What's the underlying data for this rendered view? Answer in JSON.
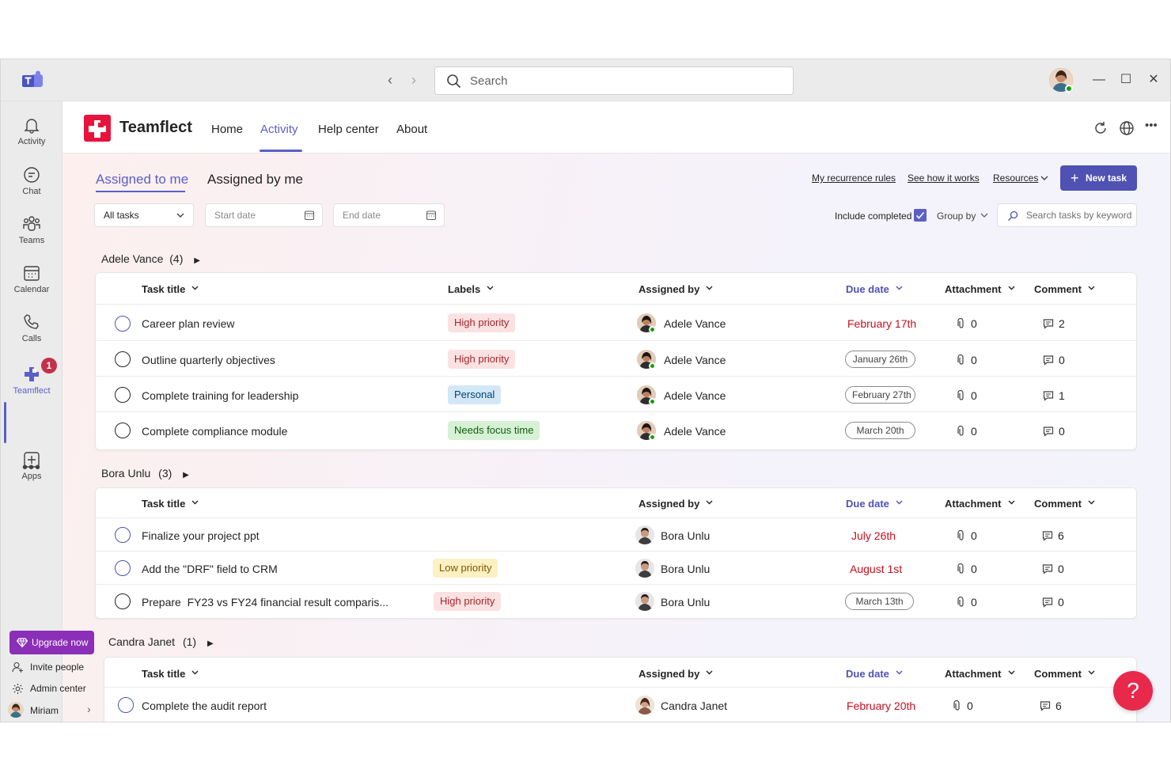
{
  "search": {
    "placeholder": "Search"
  },
  "rail": {
    "items": [
      {
        "label": "Activity",
        "icon": "bell-icon"
      },
      {
        "label": "Chat",
        "icon": "chat-icon"
      },
      {
        "label": "Teams",
        "icon": "teams-icon"
      },
      {
        "label": "Calendar",
        "icon": "calendar-icon"
      },
      {
        "label": "Calls",
        "icon": "phone-icon"
      },
      {
        "label": "Teamflect",
        "icon": "teamflect-icon",
        "badge": "1"
      },
      {
        "label": "Apps",
        "icon": "add-apps-icon"
      }
    ]
  },
  "app": {
    "name": "Teamflect",
    "tabs": [
      "Home",
      "Activity",
      "Help center",
      "About"
    ],
    "active_tab": "Activity"
  },
  "subtabs": [
    "Assigned to me",
    "Assigned by me"
  ],
  "links": {
    "recurrence": "My recurrence rules",
    "how": "See how it works",
    "resources": "Resources"
  },
  "new_task": "New task",
  "filters": {
    "task_filter": "All tasks",
    "start_date": "Start date",
    "end_date": "End date",
    "include_completed": "Include completed",
    "group_by": "Group by",
    "search_placeholder": "Search tasks by keyword"
  },
  "columns": {
    "title": "Task title",
    "labels": "Labels",
    "assigned_by": "Assigned by",
    "due": "Due date",
    "attachment": "Attachment",
    "comment": "Comment"
  },
  "groups": [
    {
      "name": "Adele Vance",
      "count": "(4)",
      "tasks": [
        {
          "title": "Career plan review",
          "label": "High priority",
          "by": "Adele Vance",
          "due": "February 17th",
          "attach": "0",
          "comments": "2"
        },
        {
          "title": "Outline quarterly objectives",
          "label": "High priority",
          "by": "Adele Vance",
          "due": "January 26th",
          "attach": "0",
          "comments": "0"
        },
        {
          "title": "Complete training for leadership",
          "label": "Personal",
          "by": "Adele Vance",
          "due": "February 27th",
          "attach": "0",
          "comments": "1"
        },
        {
          "title": "Complete compliance module",
          "label": "Needs focus time",
          "by": "Adele Vance",
          "due": "March 20th",
          "attach": "0",
          "comments": "0"
        }
      ]
    },
    {
      "name": "Bora Unlu",
      "count": "(3)",
      "tasks": [
        {
          "title": "Finalize your project ppt",
          "label": "",
          "by": "Bora Unlu",
          "due": "July 26th",
          "attach": "0",
          "comments": "6"
        },
        {
          "title": "Add the \"DRF\" field to CRM",
          "label": "Low priority",
          "by": "Bora Unlu",
          "due": "August 1st",
          "attach": "0",
          "comments": "0"
        },
        {
          "title": "Prepare  FY23 vs FY24 financial result comparis...",
          "label": "High priority",
          "by": "Bora Unlu",
          "due": "March 13th",
          "attach": "0",
          "comments": "0"
        }
      ]
    },
    {
      "name": "Candra Janet",
      "count": "(1)",
      "tasks": [
        {
          "title": "Complete the audit report",
          "label": "",
          "by": "Candra Janet",
          "due": "February 20th",
          "attach": "0",
          "comments": "6"
        }
      ]
    }
  ],
  "sidebar_bottom": {
    "upgrade": "Upgrade now",
    "invite": "Invite people",
    "admin": "Admin center",
    "user": "Miriam"
  },
  "help": "?",
  "colors": {
    "accent": "#5b5fc7",
    "brand": "#e8133c",
    "overdue": "#c50f1f",
    "upgrade": "#8b2fb8"
  }
}
